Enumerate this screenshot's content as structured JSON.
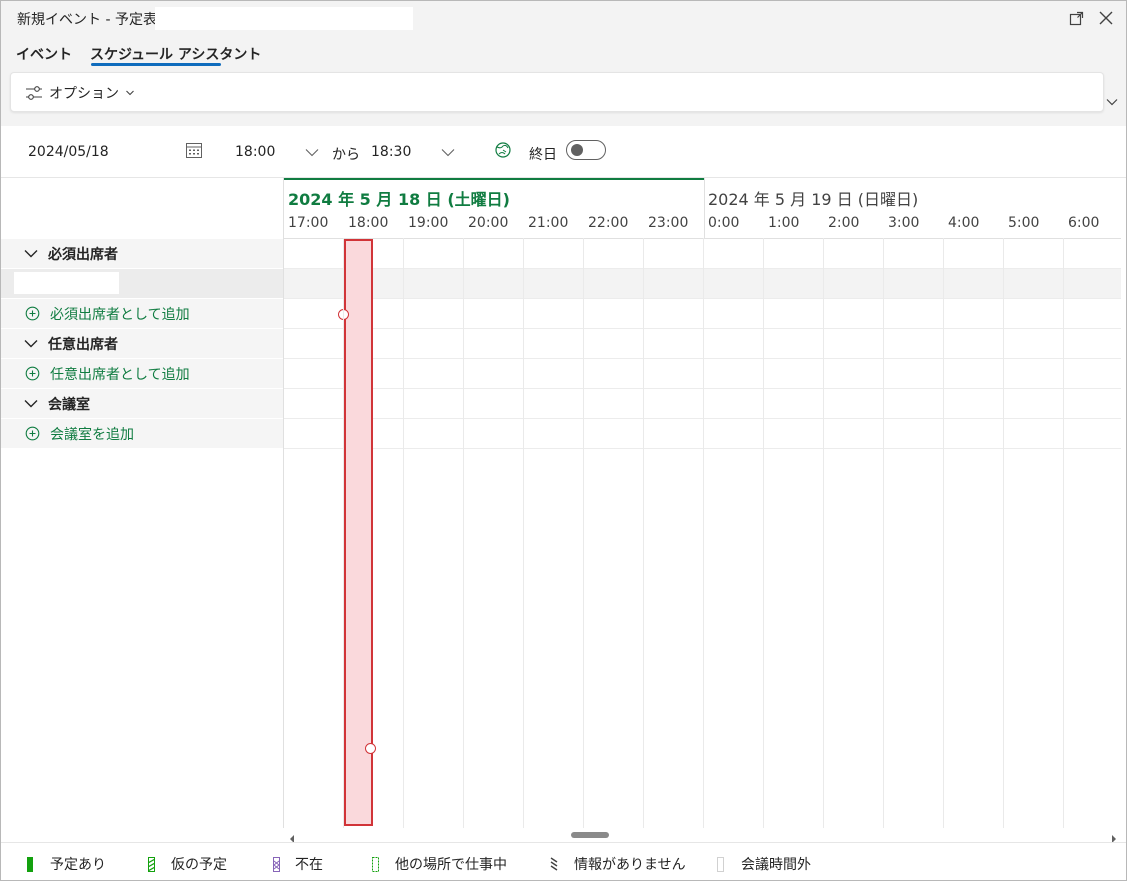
{
  "window": {
    "title": "新規イベント - 予定表 -",
    "popout_icon": "popout-icon",
    "close_icon": "close-icon"
  },
  "tabs": [
    {
      "label": "イベント",
      "active": false
    },
    {
      "label": "スケジュール アシスタント",
      "active": true
    }
  ],
  "ribbon": {
    "options_label": "オプション",
    "options_icon": "sliders-icon",
    "expand_icon": "chevron-down-icon"
  },
  "timebar": {
    "date": "2024/05/18",
    "calendar_icon": "calendar-icon",
    "start_time": "18:00",
    "from_label": "から",
    "end_time": "18:30",
    "timezone_icon": "globe-icon",
    "all_day_label": "終日",
    "all_day": false
  },
  "left_panel": {
    "required_group": "必須出席者",
    "add_required": "必須出席者として追加",
    "optional_group": "任意出席者",
    "add_optional": "任意出席者として追加",
    "rooms_group": "会議室",
    "add_room": "会議室を追加"
  },
  "grid": {
    "day1_label": "2024 年 5 月 18 日 (土曜日)",
    "day2_label": "2024 年 5 月 19 日 (日曜日)",
    "hours": [
      "17:00",
      "18:00",
      "19:00",
      "20:00",
      "21:00",
      "22:00",
      "23:00",
      "0:00",
      "1:00",
      "2:00",
      "3:00",
      "4:00",
      "5:00",
      "6:00"
    ],
    "selection_start": "18:00",
    "selection_end": "18:30",
    "accent_color": "#107c41",
    "selection_color": "#d13438"
  },
  "legend": [
    {
      "label": "予定あり",
      "color": "#13a10e",
      "pattern": "solid"
    },
    {
      "label": "仮の予定",
      "color": "#13a10e",
      "pattern": "hatched"
    },
    {
      "label": "不在",
      "color": "#8764b8",
      "pattern": "dotted"
    },
    {
      "label": "他の場所で仕事中",
      "color": "#13a10e",
      "pattern": "outline"
    },
    {
      "label": "情報がありません",
      "color": "#424242",
      "pattern": "stripes"
    },
    {
      "label": "会議時間外",
      "color": "#d1d1d1",
      "pattern": "empty"
    }
  ]
}
